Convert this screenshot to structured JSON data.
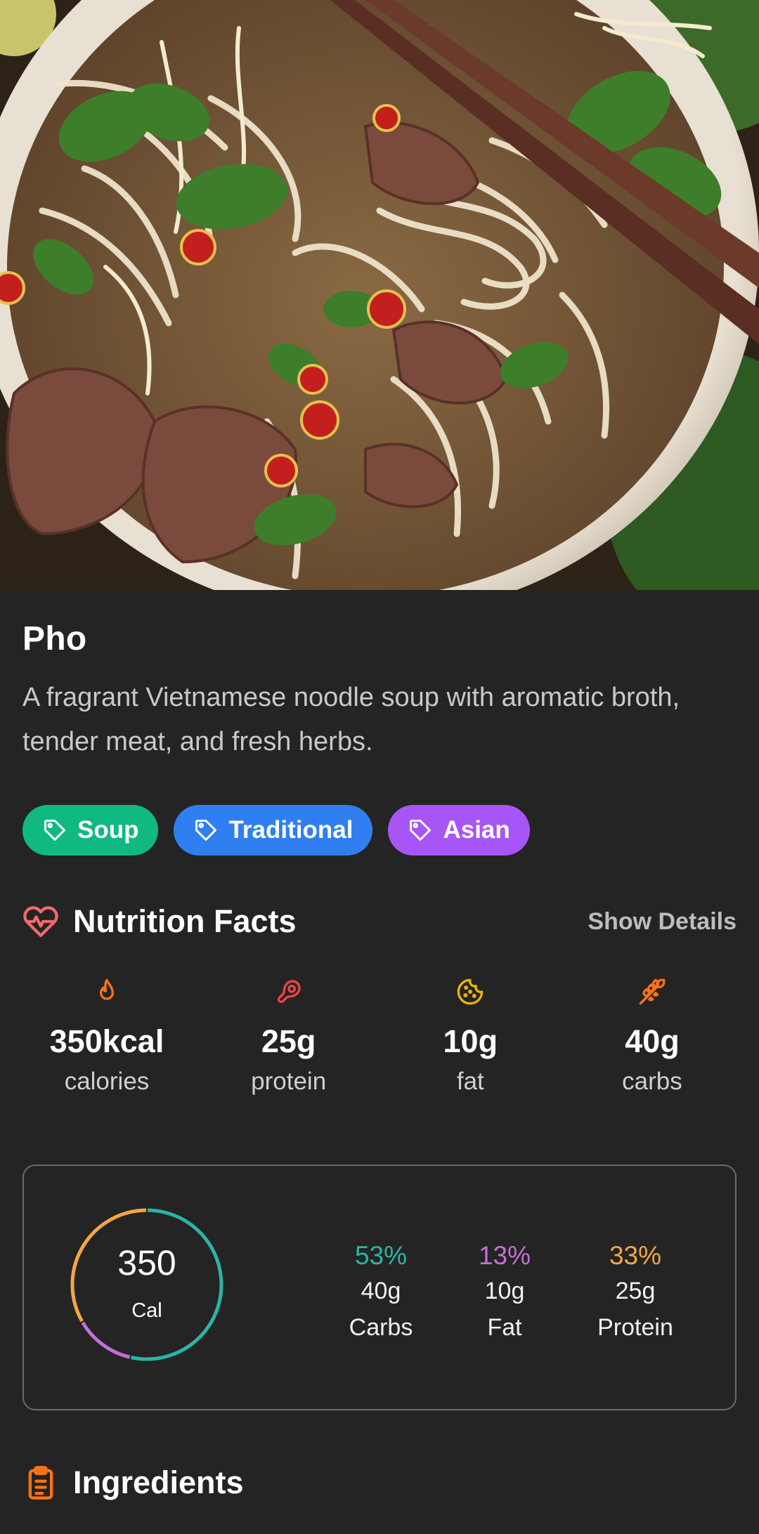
{
  "recipe": {
    "title": "Pho",
    "description": "A fragrant Vietnamese noodle soup with aromatic broth, tender meat, and fresh herbs.",
    "tags": [
      {
        "label": "Soup",
        "color": "#10b981",
        "icon": "tag-icon"
      },
      {
        "label": "Traditional",
        "color": "#2f7ff0",
        "icon": "tag-icon"
      },
      {
        "label": "Asian",
        "color": "#a855f7",
        "icon": "tag-icon"
      }
    ]
  },
  "nutrition": {
    "title": "Nutrition Facts",
    "icon": "heart-pulse-icon",
    "icon_color": "#f06a6a",
    "show_details_label": "Show Details",
    "facts": [
      {
        "value": "350kcal",
        "label": "calories",
        "icon": "flame-icon",
        "color": "#f97316"
      },
      {
        "value": "25g",
        "label": "protein",
        "icon": "meat-icon",
        "color": "#ef4444"
      },
      {
        "value": "10g",
        "label": "fat",
        "icon": "cookie-icon",
        "color": "#eab308"
      },
      {
        "value": "40g",
        "label": "carbs",
        "icon": "wheat-icon",
        "color": "#f97316"
      }
    ]
  },
  "macros": {
    "total_value": "350",
    "total_unit": "Cal",
    "items": [
      {
        "percent": "53%",
        "grams": "40g",
        "name": "Carbs",
        "color": "#2ab5a5",
        "fraction": 0.53
      },
      {
        "percent": "13%",
        "grams": "10g",
        "name": "Fat",
        "color": "#c46fd8",
        "fraction": 0.13
      },
      {
        "percent": "33%",
        "grams": "25g",
        "name": "Protein",
        "color": "#f5a742",
        "fraction": 0.33
      }
    ]
  },
  "ingredients": {
    "title": "Ingredients",
    "icon": "clipboard-list-icon",
    "icon_color": "#f97316"
  }
}
